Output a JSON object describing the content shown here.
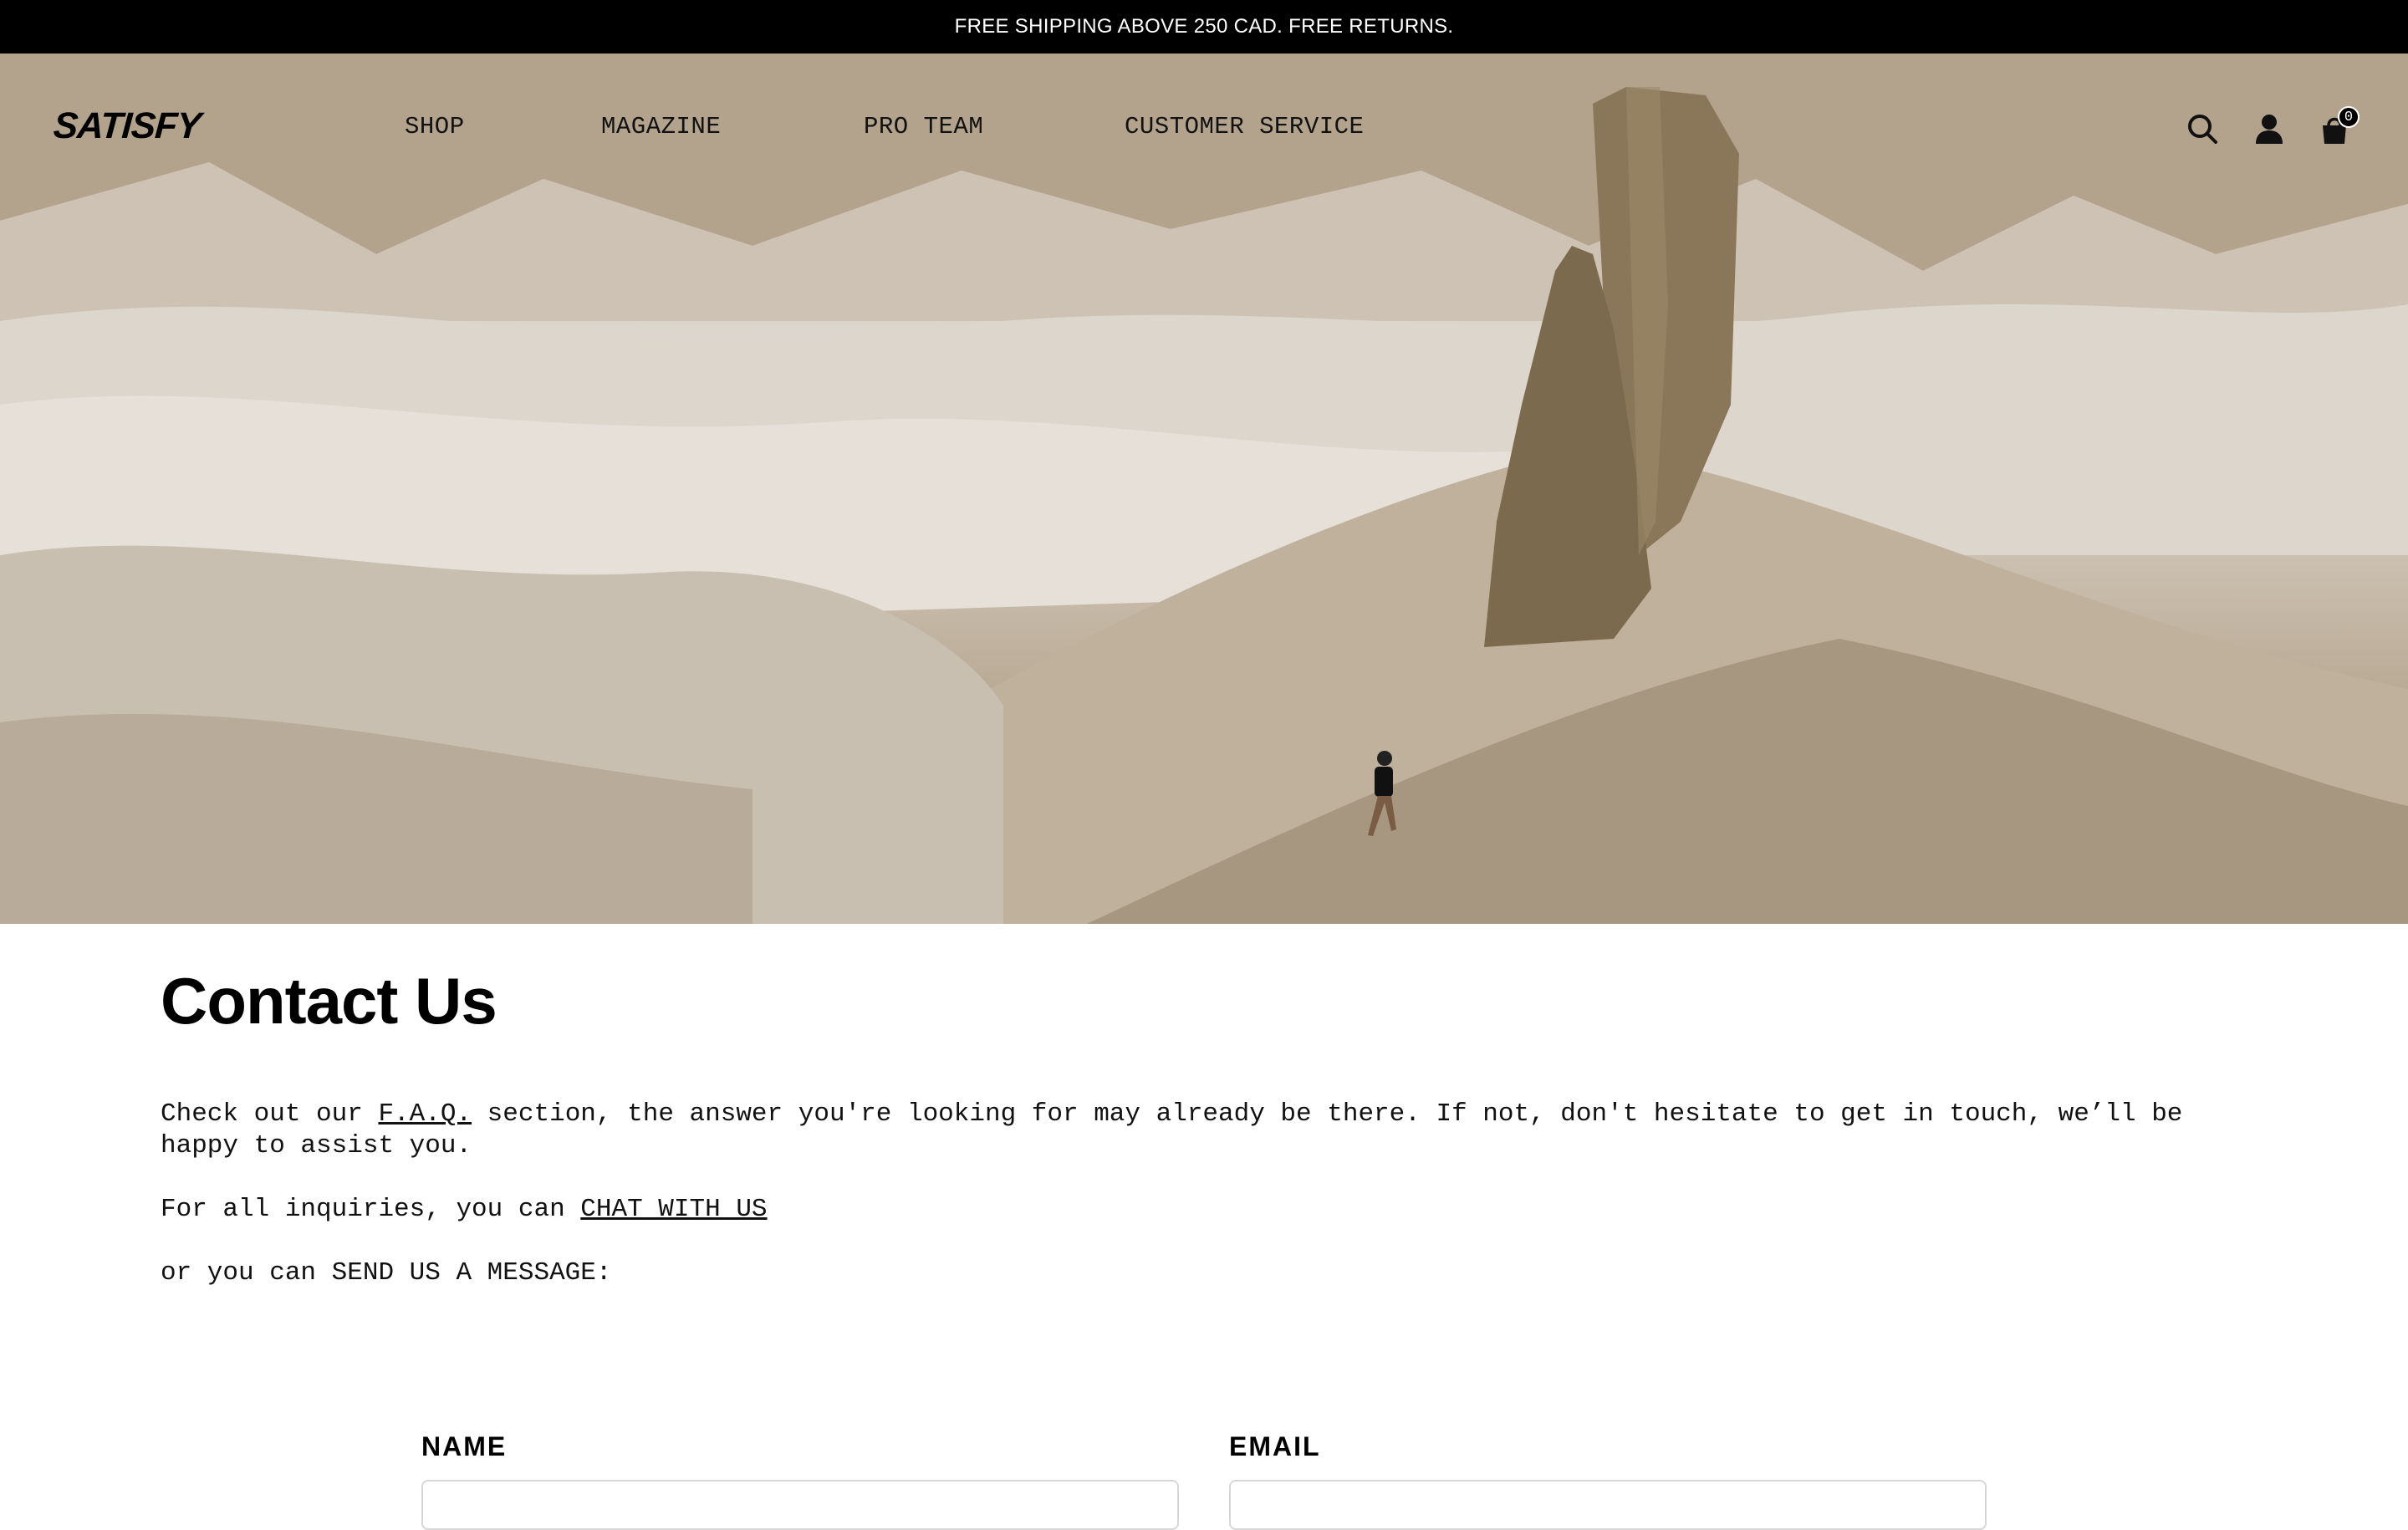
{
  "announcement": "FREE SHIPPING ABOVE 250 CAD. FREE RETURNS.",
  "header": {
    "logo": "SATISFY",
    "nav": [
      "SHOP",
      "MAGAZINE",
      "PRO TEAM",
      "CUSTOMER SERVICE"
    ],
    "icons": [
      "search-icon",
      "account-icon",
      "cart-icon"
    ],
    "cart_count": "0"
  },
  "page": {
    "title": "Contact Us",
    "intro_before": "Check out our ",
    "faq_link": "F.A.Q.",
    "intro_after": " section, the answer you're looking for may already be there. If not, don't hesitate to get in touch, we’ll be happy to assist you.",
    "inquiries_before": "For all inquiries, you can ",
    "chat_link": "CHAT WITH US",
    "message_line": "or you can SEND US A MESSAGE:"
  },
  "form": {
    "name_label": "NAME",
    "email_label": "EMAIL"
  }
}
